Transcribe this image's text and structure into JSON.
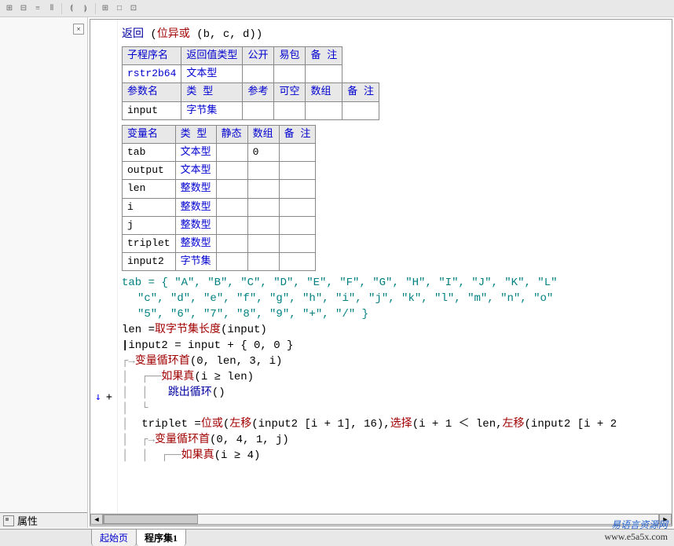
{
  "toolbar_icons": [
    "⊞",
    "⊟",
    "≡",
    "⫴",
    "⟬",
    "⟭",
    "",
    "⊞",
    "□",
    "⊡"
  ],
  "left_panel": {
    "close": "×",
    "prop_label": "属性"
  },
  "code": {
    "return_line": {
      "ret": "返回",
      "fn": "位异或",
      "args": "(b, c, d)"
    },
    "sub_table": {
      "headers1": [
        "子程序名",
        "返回值类型",
        "公开",
        "易包",
        "备 注"
      ],
      "row1": {
        "name": "rstr2b64",
        "type": "文本型"
      },
      "headers2": [
        "参数名",
        "类 型",
        "参考",
        "可空",
        "数组",
        "备 注"
      ],
      "row2": {
        "name": "input",
        "type": "字节集"
      }
    },
    "var_table": {
      "headers": [
        "变量名",
        "类 型",
        "静态",
        "数组",
        "备 注"
      ],
      "rows": [
        {
          "name": "tab",
          "type": "文本型",
          "arr": "0"
        },
        {
          "name": "output",
          "type": "文本型",
          "arr": ""
        },
        {
          "name": "len",
          "type": "整数型",
          "arr": ""
        },
        {
          "name": "i",
          "type": "整数型",
          "arr": ""
        },
        {
          "name": "j",
          "type": "整数型",
          "arr": ""
        },
        {
          "name": "triplet",
          "type": "整数型",
          "arr": ""
        },
        {
          "name": "input2",
          "type": "字节集",
          "arr": ""
        }
      ]
    },
    "tab_assign": "tab = { \"A\", \"B\", \"C\", \"D\", \"E\", \"F\", \"G\", \"H\", \"I\", \"J\", \"K\", \"L\"",
    "tab_assign2": "\"c\", \"d\", \"e\", \"f\", \"g\", \"h\", \"i\", \"j\", \"k\", \"l\", \"m\", \"n\", \"o\"",
    "tab_assign3": "\"5\", \"6\", \"7\", \"8\", \"9\", \"+\", \"/\" }",
    "len_line": {
      "lhs": "len = ",
      "fn": "取字节集长度",
      "args": " (input)"
    },
    "input2_line": "input2 = input + { 0, 0 }",
    "loop1": {
      "fn": "变量循环首",
      "args": " (0, len, 3, i)"
    },
    "if1": {
      "fn": "如果真",
      "args": " (i ≥ len)"
    },
    "break1": {
      "fn": "跳出循环",
      "args": " ()"
    },
    "triplet_line": {
      "pre": "triplet = ",
      "fn1": "位或",
      "mid1": " (",
      "fn2": "左移",
      "args2": " (input2 [i + 1], 16), ",
      "fn3": "选择",
      "args3": " (i + 1 ＜ len, ",
      "fn4": "左移",
      "args4": " (input2 [i + 2"
    },
    "loop2": {
      "fn": "变量循环首",
      "args": " (0, 4, 1, j)"
    },
    "if2": {
      "fn": "如果真",
      "args": " (i ≥ 4)"
    }
  },
  "gutter": {
    "down": "↓",
    "plus": "+",
    "cursor": "|"
  },
  "tabs": {
    "start": "起始页",
    "active": "程序集1"
  },
  "watermark": {
    "cn": "易语言资源网",
    "url": "www.e5a5x.com"
  }
}
